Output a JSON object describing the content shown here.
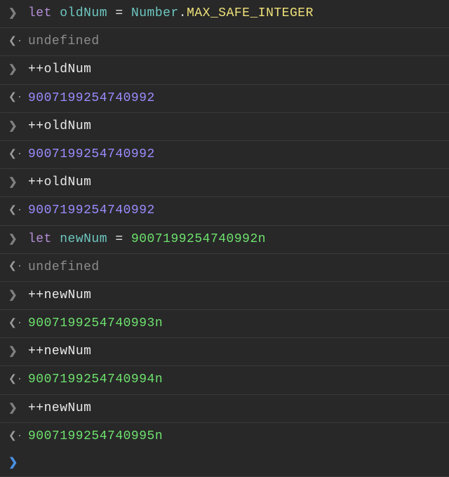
{
  "entries": [
    {
      "kind": "input",
      "segments": [
        {
          "text": "let ",
          "cls": "tok-keyword"
        },
        {
          "text": "oldNum",
          "cls": "tok-var"
        },
        {
          "text": " = ",
          "cls": "tok-op"
        },
        {
          "text": "Number",
          "cls": "tok-class"
        },
        {
          "text": ".",
          "cls": "tok-op"
        },
        {
          "text": "MAX_SAFE_INTEGER",
          "cls": "tok-prop"
        }
      ]
    },
    {
      "kind": "output",
      "segments": [
        {
          "text": "undefined",
          "cls": "tok-undef"
        }
      ]
    },
    {
      "kind": "input",
      "segments": [
        {
          "text": "++",
          "cls": "tok-plain"
        },
        {
          "text": "oldNum",
          "cls": "tok-plain"
        }
      ]
    },
    {
      "kind": "output",
      "segments": [
        {
          "text": "9007199254740992",
          "cls": "tok-num"
        }
      ]
    },
    {
      "kind": "input",
      "segments": [
        {
          "text": "++",
          "cls": "tok-plain"
        },
        {
          "text": "oldNum",
          "cls": "tok-plain"
        }
      ]
    },
    {
      "kind": "output",
      "segments": [
        {
          "text": "9007199254740992",
          "cls": "tok-num"
        }
      ]
    },
    {
      "kind": "input",
      "segments": [
        {
          "text": "++",
          "cls": "tok-plain"
        },
        {
          "text": "oldNum",
          "cls": "tok-plain"
        }
      ]
    },
    {
      "kind": "output",
      "segments": [
        {
          "text": "9007199254740992",
          "cls": "tok-num"
        }
      ]
    },
    {
      "kind": "input",
      "segments": [
        {
          "text": "let ",
          "cls": "tok-keyword"
        },
        {
          "text": "newNum",
          "cls": "tok-var"
        },
        {
          "text": " = ",
          "cls": "tok-op"
        },
        {
          "text": "9007199254740992n",
          "cls": "tok-bigint"
        }
      ]
    },
    {
      "kind": "output",
      "segments": [
        {
          "text": "undefined",
          "cls": "tok-undef"
        }
      ]
    },
    {
      "kind": "input",
      "segments": [
        {
          "text": "++",
          "cls": "tok-plain"
        },
        {
          "text": "newNum",
          "cls": "tok-plain"
        }
      ]
    },
    {
      "kind": "output",
      "segments": [
        {
          "text": "9007199254740993n",
          "cls": "tok-bigint"
        }
      ]
    },
    {
      "kind": "input",
      "segments": [
        {
          "text": "++",
          "cls": "tok-plain"
        },
        {
          "text": "newNum",
          "cls": "tok-plain"
        }
      ]
    },
    {
      "kind": "output",
      "segments": [
        {
          "text": "9007199254740994n",
          "cls": "tok-bigint"
        }
      ]
    },
    {
      "kind": "input",
      "segments": [
        {
          "text": "++",
          "cls": "tok-plain"
        },
        {
          "text": "newNum",
          "cls": "tok-plain"
        }
      ]
    },
    {
      "kind": "output",
      "segments": [
        {
          "text": "9007199254740995n",
          "cls": "tok-bigint"
        }
      ]
    }
  ],
  "icons": {
    "input": "❯",
    "output": "❮·",
    "prompt": "❯"
  },
  "prompt": ""
}
